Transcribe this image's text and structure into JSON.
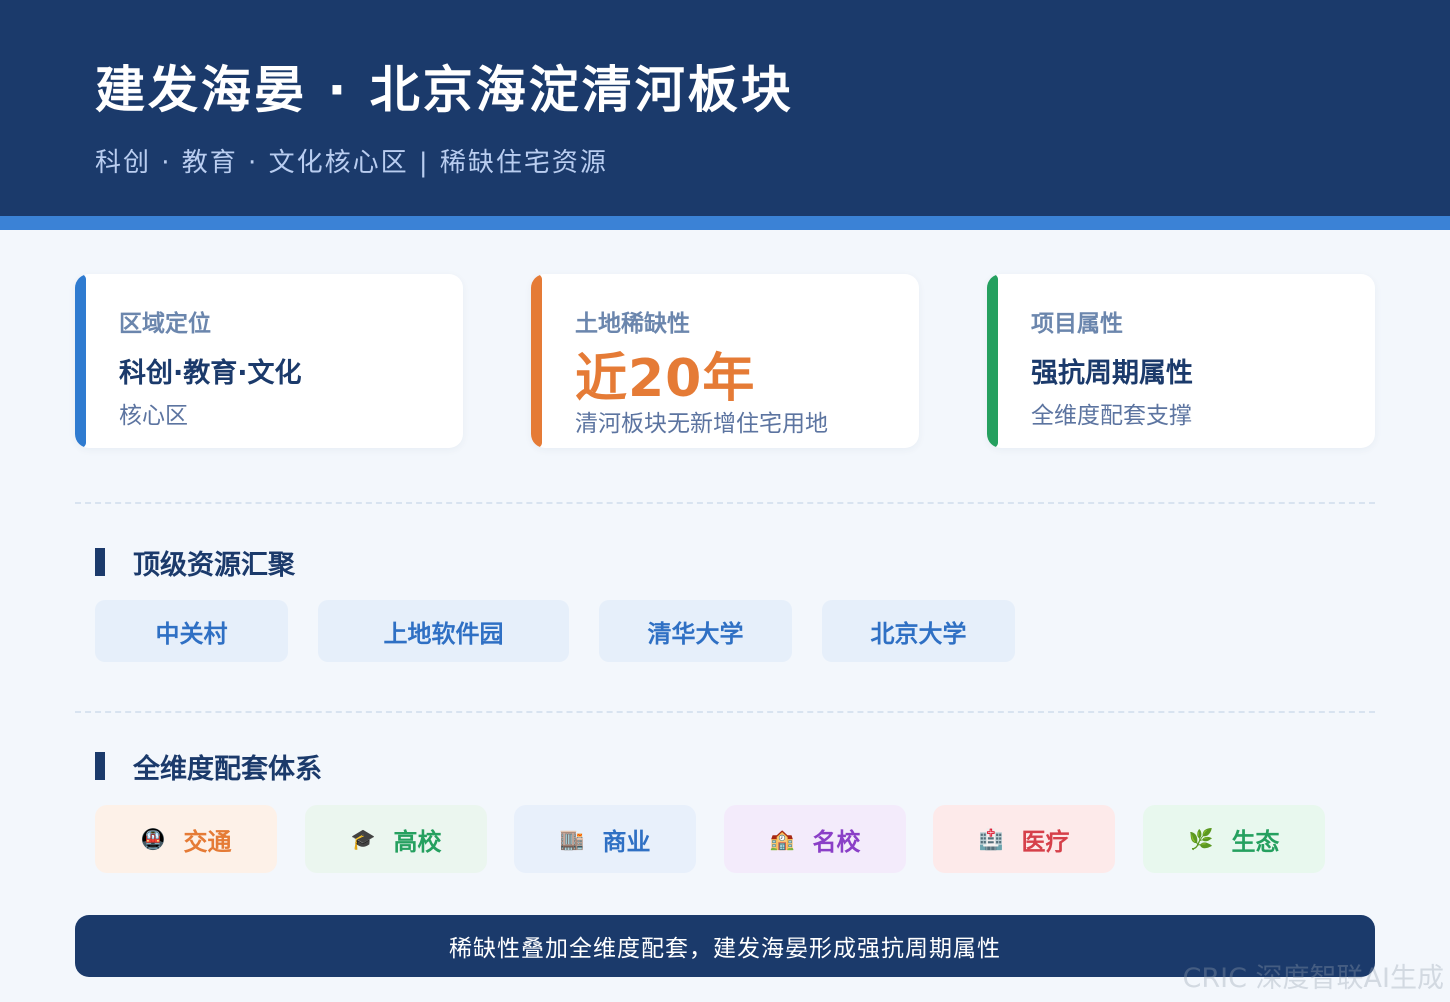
{
  "header": {
    "title": "建发海晏 · 北京海淀清河板块",
    "subtitle": "科创 · 教育 · 文化核心区 | 稀缺住宅资源"
  },
  "cards": [
    {
      "label": "区域定位",
      "value": "科创·教育·文化",
      "desc": "核心区",
      "accent": "#2f7bd0"
    },
    {
      "label": "土地稀缺性",
      "value": "近20年",
      "desc": "清河板块无新增住宅用地",
      "accent": "#e57b36"
    },
    {
      "label": "项目属性",
      "value": "强抗周期属性",
      "desc": "全维度配套支撑",
      "accent": "#25a05f"
    }
  ],
  "resources": {
    "title": "顶级资源汇聚",
    "items": [
      "中关村",
      "上地软件园",
      "清华大学",
      "北京大学"
    ]
  },
  "amenities": {
    "title": "全维度配套体系",
    "items": [
      {
        "label": "交通",
        "icon": "🚇",
        "icon_name": "metro-icon",
        "color": "#e57b36",
        "bg": "#fdf1e8"
      },
      {
        "label": "高校",
        "icon": "🎓",
        "icon_name": "graduation-cap-icon",
        "color": "#25a05f",
        "bg": "#ebf6ef"
      },
      {
        "label": "商业",
        "icon": "🏬",
        "icon_name": "mall-icon",
        "color": "#2f70c4",
        "bg": "#e8f0fb"
      },
      {
        "label": "名校",
        "icon": "🏫",
        "icon_name": "school-icon",
        "color": "#8a3fc7",
        "bg": "#f3ebfb"
      },
      {
        "label": "医疗",
        "icon": "🏥",
        "icon_name": "hospital-icon",
        "color": "#d6404a",
        "bg": "#fdeaea"
      },
      {
        "label": "生态",
        "icon": "🌿",
        "icon_name": "leaf-icon",
        "color": "#25a05f",
        "bg": "#e8f8ee"
      }
    ]
  },
  "banner": "稀缺性叠加全维度配套，建发海晏形成强抗周期属性",
  "watermark": "CRIC 深度智联AI生成"
}
